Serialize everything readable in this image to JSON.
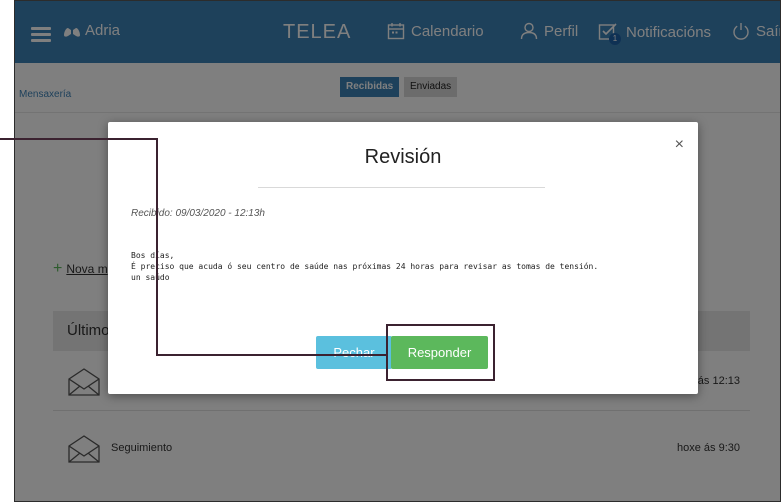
{
  "topbar": {
    "user_name": "Adria",
    "app_title": "TELEA",
    "nav": {
      "calendar": "Calendario",
      "profile": "Perfil",
      "notifications": "Notificacións",
      "notifications_count": "1",
      "exit": "Saír"
    }
  },
  "subbar": {
    "breadcrumb": "Mensaxería",
    "tabs": {
      "received": "Recibidas",
      "sent": "Enviadas"
    }
  },
  "content": {
    "new_message_label": "Nova m",
    "latest_header": "Últimos",
    "messages": [
      {
        "subject": "",
        "time": "ás 12:13"
      },
      {
        "subject": "Seguimiento",
        "time": "hoxe ás 9:30"
      }
    ]
  },
  "modal": {
    "title": "Revisión",
    "received": "Recibido: 09/03/2020 - 12:13h",
    "body": "Bos días,\nÉ preciso que acuda ó seu centro de saúde nas próximas 24 horas para revisar as tomas de tensión.\nun saúdo",
    "buttons": {
      "close": "Pechar",
      "reply": "Responder"
    },
    "close_glyph": "×"
  },
  "colors": {
    "topbar": "#3d82b7",
    "tab_active": "#3d82b7",
    "btn_close": "#5bc0de",
    "btn_reply": "#5cb85c"
  }
}
